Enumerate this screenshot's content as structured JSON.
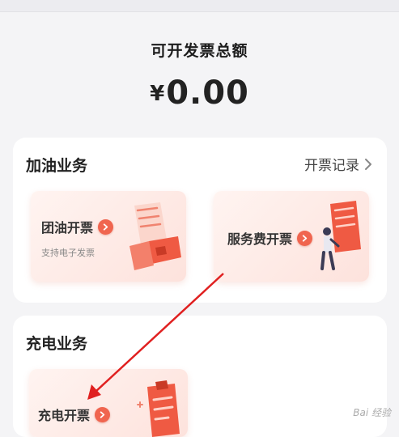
{
  "summary": {
    "title": "可开发票总额",
    "currency_symbol": "¥",
    "amount": "0.00"
  },
  "fuel_section": {
    "title": "加油业务",
    "records_link": "开票记录",
    "cards": [
      {
        "label": "团油开票",
        "sublabel": "支持电子发票"
      },
      {
        "label": "服务费开票"
      }
    ]
  },
  "charging_section": {
    "title": "充电业务",
    "cards": [
      {
        "label": "充电开票"
      }
    ]
  },
  "icons": {
    "chevron": "chevron-right-icon",
    "badge_arrow": "arrow-right-badge-icon",
    "annotation": "red-arrow-annotation"
  },
  "colors": {
    "accent": "#f0654f",
    "annotation": "#e02020",
    "card_bg": "#fde2dc"
  },
  "watermark": "Bai 经验"
}
